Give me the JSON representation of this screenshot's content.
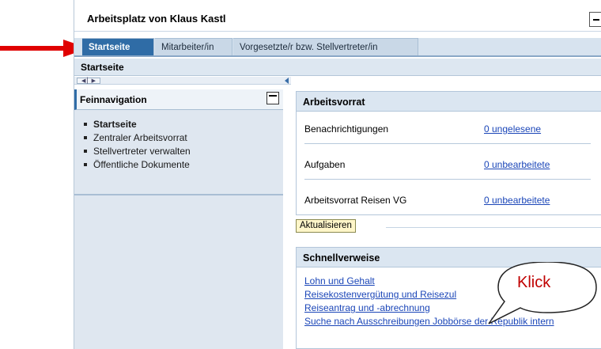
{
  "window": {
    "title": "Arbeitsplatz von Klaus Kastl"
  },
  "tabs": [
    {
      "label": "Startseite"
    },
    {
      "label": "Mitarbeiter/in"
    },
    {
      "label": "Vorgesetzte/r bzw. Stellvertreter/in"
    }
  ],
  "page": {
    "heading": "Startseite"
  },
  "nav": {
    "title": "Feinnavigation",
    "items": [
      {
        "label": "Startseite"
      },
      {
        "label": "Zentraler Arbeitsvorrat"
      },
      {
        "label": "Stellvertreter verwalten"
      },
      {
        "label": "Öffentliche Dokumente"
      }
    ]
  },
  "worklist": {
    "title": "Arbeitsvorrat",
    "rows": [
      {
        "label": "Benachrichtigungen",
        "link": "0 ungelesene"
      },
      {
        "label": "Aufgaben",
        "link": "0 unbearbeitete"
      },
      {
        "label": "Arbeitsvorrat Reisen VG",
        "link": "0 unbearbeitete"
      }
    ],
    "refresh_label": "Aktualisieren"
  },
  "quicklinks": {
    "title": "Schnellverweise",
    "items": [
      {
        "label": "Lohn und Gehalt"
      },
      {
        "label": "Reisekostenvergütung und Reisezul"
      },
      {
        "label": "Reiseantrag und -abrechnung"
      },
      {
        "label": "Suche nach Ausschreibungen Jobbörse der Republik intern"
      }
    ]
  },
  "annotation": {
    "callout": "Klick",
    "color": "#c00000"
  }
}
